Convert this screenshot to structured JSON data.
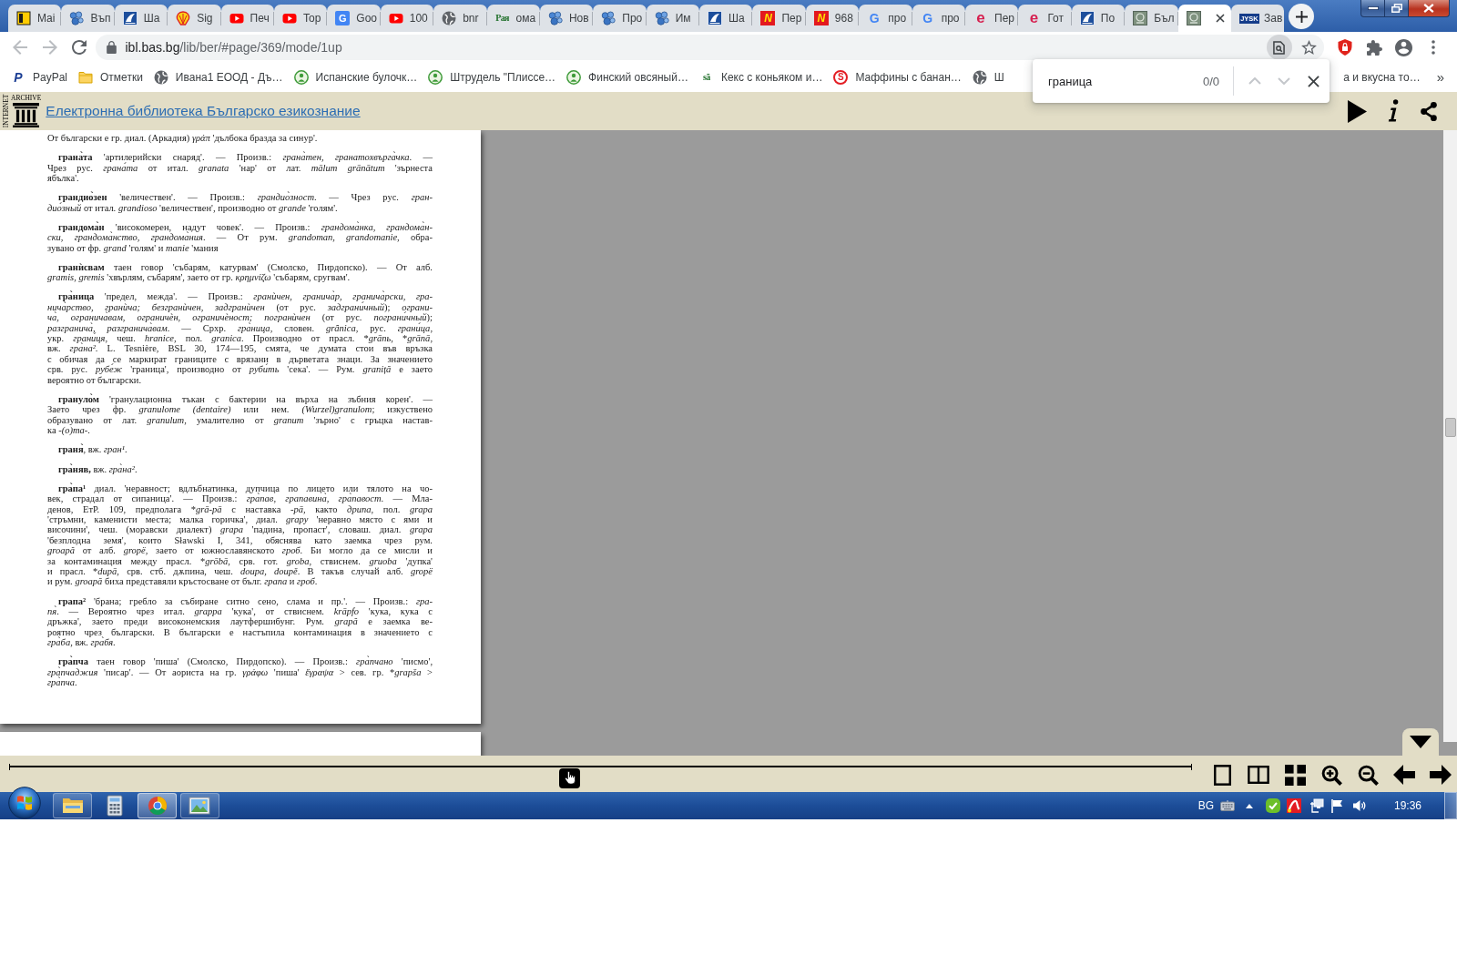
{
  "browser": {
    "tabs": [
      {
        "kind": "tile",
        "title": "Mai",
        "selected": false
      },
      {
        "kind": "paw",
        "title": "Въп",
        "selected": false
      },
      {
        "kind": "sail",
        "title": "Ша",
        "selected": false
      },
      {
        "kind": "shell",
        "title": "Sig",
        "selected": false
      },
      {
        "kind": "play",
        "title": "Печ",
        "selected": false
      },
      {
        "kind": "play",
        "title": "Top",
        "selected": false
      },
      {
        "kind": "translate",
        "icon_text": "G",
        "title": "Goo",
        "selected": false
      },
      {
        "kind": "play",
        "title": "100",
        "selected": false
      },
      {
        "kind": "globe",
        "title": "bnr",
        "selected": false
      },
      {
        "kind": "serif",
        "icon_text": "Рая",
        "title": "ома",
        "selected": false
      },
      {
        "kind": "paw",
        "title": "Нов",
        "selected": false
      },
      {
        "kind": "paw",
        "title": "Про",
        "selected": false
      },
      {
        "kind": "paw",
        "title": "Им",
        "selected": false
      },
      {
        "kind": "sail",
        "title": "Ша",
        "selected": false
      },
      {
        "kind": "hbox",
        "icon_text": "N",
        "title": "Пер",
        "selected": false
      },
      {
        "kind": "hbox",
        "icon_text": "N",
        "title": "968",
        "selected": false
      },
      {
        "kind": "gmark",
        "icon_text": "G",
        "title": "про",
        "selected": false
      },
      {
        "kind": "gmark",
        "icon_text": "G",
        "title": "про",
        "selected": false
      },
      {
        "kind": "ecircle",
        "icon_text": "e",
        "title": "Пер",
        "selected": false
      },
      {
        "kind": "ecircle",
        "icon_text": "e",
        "title": "Гот",
        "selected": false
      },
      {
        "kind": "sail",
        "title": "По",
        "selected": false
      },
      {
        "kind": "image",
        "title": "Бъл",
        "selected": false
      },
      {
        "kind": "image",
        "selected": true
      },
      {
        "kind": "wordmark",
        "icon_text": "JYSK",
        "title": "Зав",
        "selected": false
      }
    ],
    "nav_buttons": [
      {
        "kind": "back",
        "disabled": true
      },
      {
        "kind": "forward",
        "disabled": true
      },
      {
        "kind": "reload",
        "disabled": false
      }
    ],
    "address_bar": {
      "host": "ibl.bas.bg",
      "path": "/lib/ber/#page/369/mode/1up"
    },
    "bookmarks": [
      {
        "kind": "pmark",
        "icon_text": "P",
        "label": "PayPal"
      },
      {
        "kind": "folder",
        "label": "Отметки"
      },
      {
        "kind": "globe",
        "label": "Ивана1 ЕООД - Дъ…"
      },
      {
        "kind": "emblem",
        "label": "Испанские булочк…"
      },
      {
        "kind": "emblem",
        "label": "Штрудель \"Плиссе…"
      },
      {
        "kind": "emblem",
        "label": "Финский овсяный…"
      },
      {
        "kind": "serif",
        "icon_text": "sã",
        "label": "Кекс с коньяком и…"
      },
      {
        "kind": "sring",
        "icon_text": "S",
        "label": "Маффины с банан…"
      },
      {
        "kind": "globe",
        "label": "Ш"
      },
      {
        "kind": "plain",
        "label": "а и вкусна то…"
      }
    ],
    "bookmarks_overflow": "»",
    "find_bar": {
      "query": "граница",
      "count": "0/0",
      "buttons": [
        {
          "kind": "up",
          "disabled": true
        },
        {
          "kind": "down",
          "disabled": true
        },
        {
          "kind": "close",
          "disabled": false
        }
      ]
    }
  },
  "reader": {
    "logo": {
      "top": "ARCHIVE",
      "side": "INTERNET"
    },
    "title": "Електронна библиотека Българско езикознание",
    "entries": [
      {
        "kind": "continuation",
        "lines": [
          [
            "От български е гр. диал. (Аркадия) *γράπ* 'дълбока бразда за синур'."
          ]
        ]
      },
      {
        "kind": "entry",
        "lines": [
          [
            "**грана̀та** 'артилерийски снаряд'. — Произв.: *грана̀тен, гранатохвърга̀чка*. —"
          ],
          [
            "Чрез рус. *грана́та* от итал. *granata* 'нар' от лат. *mālum grānātum* 'зърнеста"
          ],
          [
            "ябълка'."
          ]
        ]
      },
      {
        "kind": "entry",
        "lines": [
          [
            "**грандио̀зен** 'величествен'. — Произв.: *грандио̀зност*. — Чрез рус. *гран-*"
          ],
          [
            "*дио́зный* от итал. *grandioso* 'величествен', производно от *grande* 'голям'."
          ]
        ]
      },
      {
        "kind": "entry",
        "lines": [
          [
            "**грандома̀н** 'високомерен, надут човек'. — Произв.: *грандома̀нка, грандома̀н-*"
          ],
          [
            "*ски, грандома̀нство, грандома̀ния*. — От рум. *grandoman, grandomanie*, обра-"
          ],
          [
            "зувано от фр. *grand* 'голям' и *manie* 'мания"
          ]
        ]
      },
      {
        "kind": "entry",
        "lines": [
          [
            "**гранѝсвам** таен говор 'събарям, катурвам' (Смолско, Пирдопско). — От алб."
          ],
          [
            "*gramis, gremis* 'хвърлям, събарям', заето от гр. *κρημνίζω* 'събарям, сругвам'."
          ]
        ]
      },
      {
        "kind": "entry",
        "lines": [
          [
            "**гра̀ница** 'предел, межда'. — Произв.: *гранѝчен, гранича̀р, гранича̀рски, гра-*"
          ],
          [
            "*нича̀рство, гранѝча; безгранѝчен, задгранѝчен* (от рус. *задграни́чный*); *ограни-*"
          ],
          [
            "*ча̀, огранича̀вам, ограничѐн, ограничѐност; погранѝчен* (от рус. *пограни́чный*);"
          ],
          [
            "*разгранича̀, разгранича̀вам*. — Срхр. *гра̀ница*, словен. *grȃnica*, рус. *грани́ца*,"
          ],
          [
            "укр. *грани́ця*, чеш. *hranice*, пол. *granica*. Производно от прасл. ",
            "*",
            "*grānь*, ",
            "*",
            "*grānā*,"
          ],
          [
            "вж. *гра̀на²*. L. Tesnière, BSL 30, 174—195, смята, че думата стои във връзка"
          ],
          [
            "с обичая да се маркират границите с врязани в дърветата знаци. За значението"
          ],
          [
            "срв. рус. *рубе́ж* 'граница', производно от *руби́ть* 'сека'. — Рум. *graniță* е заето"
          ],
          [
            "вероятно от български."
          ]
        ]
      },
      {
        "kind": "entry",
        "lines": [
          [
            "**грануло̀м** 'гранулационна тъкан с бактерии на върха на зъбния корен'. —"
          ],
          [
            "Заето чрез фр. *granulome (dentaire)* или нем. *(Wurzel)granulom*; изкуствено"
          ],
          [
            "образувано от лат. *granulum*, умалително от *granum* 'зърно' с гръцка настав-"
          ],
          [
            "ка *-(o)ma-*."
          ]
        ]
      },
      {
        "kind": "entry",
        "lines": [
          [
            "**граня̀**, вж. *гран¹*."
          ]
        ]
      },
      {
        "kind": "entry",
        "lines": [
          [
            "**гра̀няв,** вж. *гра̀на²*."
          ]
        ]
      },
      {
        "kind": "entry",
        "lines": [
          [
            "**гра̀па¹** диал. 'неравност; вдлъбнатинка, дупчица по лицето или тялото на чо-"
          ],
          [
            "век, страдал от сипаница'. — Произв.: *гра̀пав, грапавина̀, гра̀павост*. — Мла-"
          ],
          [
            "денов, ЕтР. 109, предполага ",
            "*",
            "*grā-pā* с наставка *-pā*, както *дрипа*, пол. *grapa*"
          ],
          [
            "'стръмни, каменисти места; малка горичка', диал. *grapy* 'неравно място с ями и"
          ],
          [
            "височини', чеш. (моравски диалект) *grapa* 'падина, пропаст', словаш. диал. *grapa*"
          ],
          [
            "'безплодна земя', които Sławski I, 341, обяснява като заемка чрез рум."
          ],
          [
            "*groapă* от алб. *gropë*, заето от южнославянското *гроб*. Би могло да се мисли и"
          ],
          [
            "за контаминация между прасл. ",
            "*",
            "*grōbā*, срв. гот. *groba*, ствиснем. *gruoba* 'дупка'"
          ],
          [
            "и прасл. ",
            "*",
            "*dupā*, срв. стб. дѫпина, чеш. *doupa, doupě*. В такъв случай алб. *gropë*"
          ],
          [
            "и рум. *groapă* биха представяли кръстосване от бълг. *грапа* и *гроб*."
          ]
        ]
      },
      {
        "kind": "entry",
        "lines": [
          [
            "**грапа²** 'брана; гребло за събиране ситно сено, слама и пр.'. — Произв.: *гра-*"
          ],
          [
            "*пя̀*. — Вероятно чрез итал. *grappa* 'кука', от ствиснем. *krāpfo* 'кука, кука с"
          ],
          [
            "дръжка', заето преди високонемския лаутфершибунг. Рум. *grapă* е заемка ве-"
          ],
          [
            "роятно чрез български. В български е настъпила контаминация в значението с"
          ],
          [
            "*гра̀ба*, вж. *гра̀бя*."
          ]
        ]
      },
      {
        "kind": "entry",
        "lines": [
          [
            "**гра̀пча** таен говор 'пиша' (Смолско, Пирдопско). — Произв.: *гра̀пчано* 'писмо',"
          ],
          [
            "*гра̀пчаджия* 'писар'. — От аориста на гр. *γράφω* 'пиша' *ἔγραψα* > сев. гр. ",
            "*",
            "*grapša* >"
          ],
          [
            "*гра̀пча*."
          ]
        ]
      }
    ],
    "navigation": {
      "level": 0.474
    }
  },
  "taskbar": {
    "apps": [
      {
        "kind": "folder",
        "running": true,
        "selected": false
      },
      {
        "kind": "calculator",
        "running": false,
        "selected": false
      },
      {
        "kind": "browser",
        "running": true,
        "selected": true
      },
      {
        "kind": "viewer",
        "running": true,
        "selected": false
      }
    ],
    "language": "BG",
    "time": "19:36"
  }
}
